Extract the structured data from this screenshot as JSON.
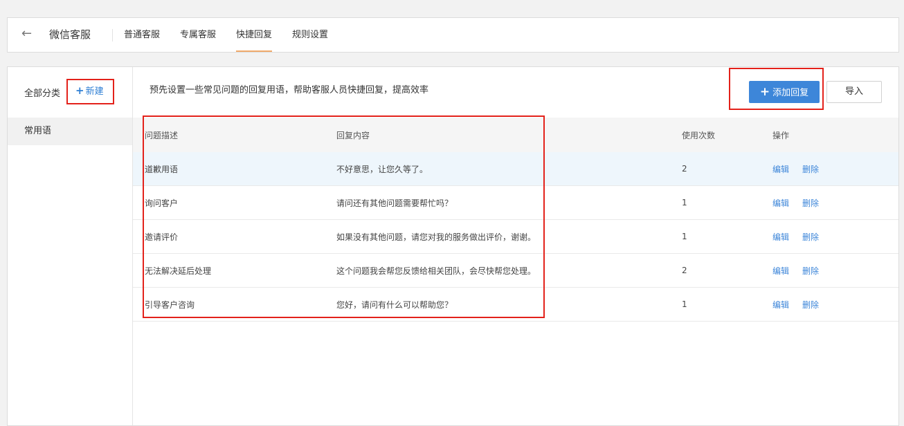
{
  "header": {
    "title": "微信客服",
    "tabs": [
      {
        "label": "普通客服",
        "active": false
      },
      {
        "label": "专属客服",
        "active": false
      },
      {
        "label": "快捷回复",
        "active": true
      },
      {
        "label": "规则设置",
        "active": false
      }
    ]
  },
  "sidebar": {
    "all_label": "全部分类",
    "new_label": "新建",
    "items": [
      {
        "label": "常用语"
      }
    ]
  },
  "main": {
    "description": "预先设置一些常见问题的回复用语，帮助客服人员快捷回复，提高效率",
    "add_label": "添加回复",
    "import_label": "导入"
  },
  "table": {
    "headers": [
      "问题描述",
      "回复内容",
      "使用次数",
      "操作"
    ],
    "rows": [
      {
        "question": "道歉用语",
        "reply": "不好意思，让您久等了。",
        "count": "2",
        "edit": "编辑",
        "delete": "删除"
      },
      {
        "question": "询问客户",
        "reply": "请问还有其他问题需要帮忙吗？",
        "count": "1",
        "edit": "编辑",
        "delete": "删除"
      },
      {
        "question": "邀请评价",
        "reply": "如果没有其他问题，请您对我的服务做出评价，谢谢。",
        "count": "1",
        "edit": "编辑",
        "delete": "删除"
      },
      {
        "question": "无法解决延后处理",
        "reply": "这个问题我会帮您反馈给相关团队，会尽快帮您处理。",
        "count": "2",
        "edit": "编辑",
        "delete": "删除"
      },
      {
        "question": "引导客户咨询",
        "reply": "您好，请问有什么可以帮助您？",
        "count": "1",
        "edit": "编辑",
        "delete": "删除"
      }
    ]
  },
  "colors": {
    "accent": "#3d86d9",
    "highlight_row": "#eef6fc",
    "annotation_red": "#e3211a",
    "tab_underline": "#f0a96b"
  }
}
